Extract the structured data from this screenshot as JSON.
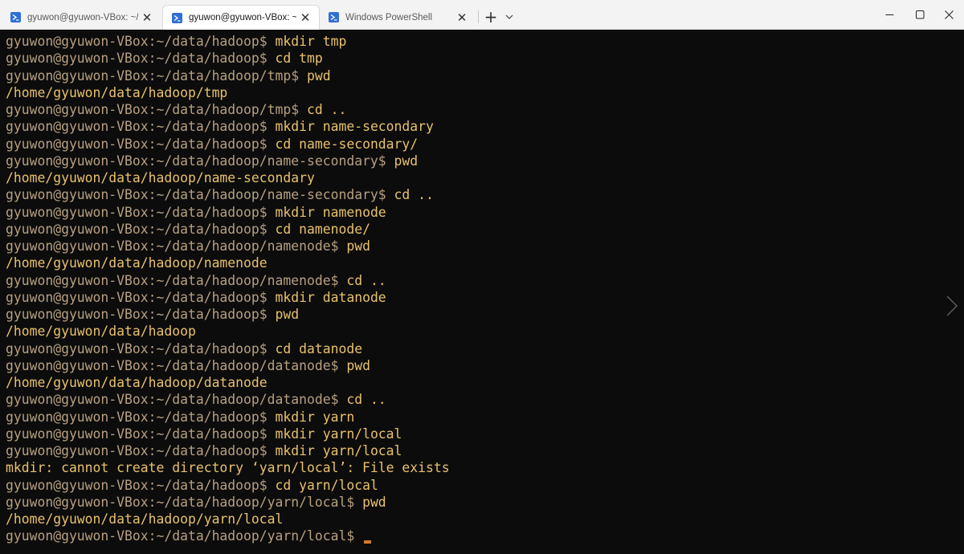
{
  "tabs": [
    {
      "title": "gyuwon@gyuwon-VBox: ~/ha",
      "active": false
    },
    {
      "title": "gyuwon@gyuwon-VBox: ~/d",
      "active": true
    },
    {
      "title": "Windows PowerShell",
      "active": false
    }
  ],
  "titlebar": {
    "new_tab_label": "+",
    "tab_close_label": "✕"
  },
  "terminal": {
    "lines": [
      {
        "prompt": "gyuwon@gyuwon-VBox:~/data/hadoop$",
        "cmd": " mkdir tmp"
      },
      {
        "prompt": "gyuwon@gyuwon-VBox:~/data/hadoop$",
        "cmd": " cd tmp"
      },
      {
        "prompt": "gyuwon@gyuwon-VBox:~/data/hadoop/tmp$",
        "cmd": " pwd"
      },
      {
        "output": "/home/gyuwon/data/hadoop/tmp"
      },
      {
        "prompt": "gyuwon@gyuwon-VBox:~/data/hadoop/tmp$",
        "cmd": " cd .."
      },
      {
        "prompt": "gyuwon@gyuwon-VBox:~/data/hadoop$",
        "cmd": " mkdir name-secondary"
      },
      {
        "prompt": "gyuwon@gyuwon-VBox:~/data/hadoop$",
        "cmd": " cd name-secondary/"
      },
      {
        "prompt": "gyuwon@gyuwon-VBox:~/data/hadoop/name-secondary$",
        "cmd": " pwd"
      },
      {
        "output": "/home/gyuwon/data/hadoop/name-secondary"
      },
      {
        "prompt": "gyuwon@gyuwon-VBox:~/data/hadoop/name-secondary$",
        "cmd": " cd .."
      },
      {
        "prompt": "gyuwon@gyuwon-VBox:~/data/hadoop$",
        "cmd": " mkdir namenode"
      },
      {
        "prompt": "gyuwon@gyuwon-VBox:~/data/hadoop$",
        "cmd": " cd namenode/"
      },
      {
        "prompt": "gyuwon@gyuwon-VBox:~/data/hadoop/namenode$",
        "cmd": " pwd"
      },
      {
        "output": "/home/gyuwon/data/hadoop/namenode"
      },
      {
        "prompt": "gyuwon@gyuwon-VBox:~/data/hadoop/namenode$",
        "cmd": " cd .."
      },
      {
        "prompt": "gyuwon@gyuwon-VBox:~/data/hadoop$",
        "cmd": " mkdir datanode"
      },
      {
        "prompt": "gyuwon@gyuwon-VBox:~/data/hadoop$",
        "cmd": " pwd"
      },
      {
        "output": "/home/gyuwon/data/hadoop"
      },
      {
        "prompt": "gyuwon@gyuwon-VBox:~/data/hadoop$",
        "cmd": " cd datanode"
      },
      {
        "prompt": "gyuwon@gyuwon-VBox:~/data/hadoop/datanode$",
        "cmd": " pwd"
      },
      {
        "output": "/home/gyuwon/data/hadoop/datanode"
      },
      {
        "prompt": "gyuwon@gyuwon-VBox:~/data/hadoop/datanode$",
        "cmd": " cd .."
      },
      {
        "prompt": "gyuwon@gyuwon-VBox:~/data/hadoop$",
        "cmd": " mkdir yarn"
      },
      {
        "prompt": "gyuwon@gyuwon-VBox:~/data/hadoop$",
        "cmd": " mkdir yarn/local"
      },
      {
        "prompt": "gyuwon@gyuwon-VBox:~/data/hadoop$",
        "cmd": " mkdir yarn/local"
      },
      {
        "output": "mkdir: cannot create directory ‘yarn/local’: File exists"
      },
      {
        "prompt": "gyuwon@gyuwon-VBox:~/data/hadoop$",
        "cmd": " cd yarn/local"
      },
      {
        "prompt": "gyuwon@gyuwon-VBox:~/data/hadoop/yarn/local$",
        "cmd": " pwd"
      },
      {
        "output": "/home/gyuwon/data/hadoop/yarn/local"
      },
      {
        "prompt": "gyuwon@gyuwon-VBox:~/data/hadoop/yarn/local$",
        "cmd": " ",
        "cursor": true
      }
    ]
  },
  "colors": {
    "background": "#0c0c0c",
    "prompt": "#b6a080",
    "text": "#e8c16b",
    "cursor": "#d77b2c",
    "tab_icon": "#2f6fd6"
  },
  "icons": {
    "tab_icon": "powershell-icon",
    "new_tab": "plus-icon",
    "dropdown": "chevron-down-icon",
    "minimize": "minimize-icon",
    "maximize": "maximize-icon",
    "close": "close-icon",
    "next": "chevron-right-icon"
  }
}
